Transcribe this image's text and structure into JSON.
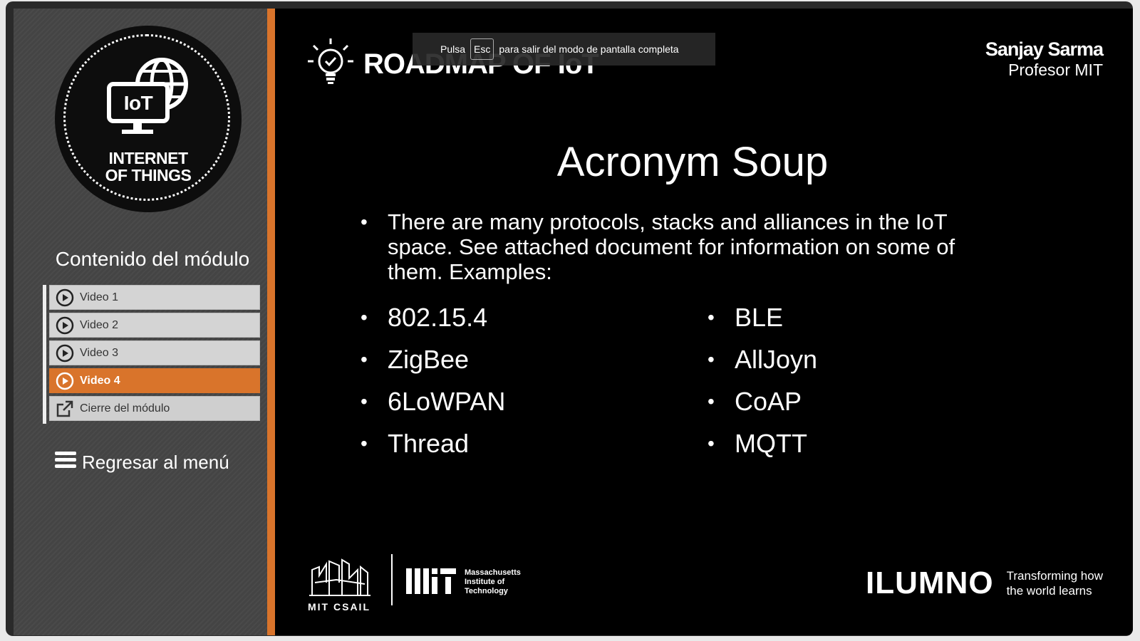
{
  "sidebar": {
    "logo": {
      "line1": "INTERNET",
      "line2": "OF THINGS",
      "badge": "IoT"
    },
    "module_title": "Contenido del módulo",
    "items": [
      {
        "label": "Video 1",
        "icon": "play-circle-icon",
        "active": false
      },
      {
        "label": "Video 2",
        "icon": "play-circle-icon",
        "active": false
      },
      {
        "label": "Video 3",
        "icon": "play-circle-icon",
        "active": false
      },
      {
        "label": "Video 4",
        "icon": "play-circle-icon",
        "active": true
      },
      {
        "label": "Cierre del módulo",
        "icon": "external-link-icon",
        "active": false
      }
    ],
    "back_label": "Regresar al menú"
  },
  "header": {
    "title": "ROADMAP OF IoT",
    "presenter_name": "Sanjay Sarma",
    "presenter_role": "Profesor MIT"
  },
  "toast": {
    "prefix": "Pulsa",
    "key": "Esc",
    "suffix": "para salir del modo de pantalla completa"
  },
  "slide": {
    "title": "Acronym Soup",
    "intro": "There are many protocols, stacks and alliances in the IoT space. See attached document for information on some of them. Examples:",
    "left_column": [
      "802.15.4",
      "ZigBee",
      "6LoWPAN",
      "Thread"
    ],
    "right_column": [
      "BLE",
      "AllJoyn",
      "CoAP",
      "MQTT"
    ]
  },
  "footer": {
    "csail": "MIT CSAIL",
    "mit_line1": "Massachusetts",
    "mit_line2": "Institute of",
    "mit_line3": "Technology",
    "ilumno": "ILUMNO",
    "tagline1": "Transforming how",
    "tagline2": "the world learns"
  },
  "colors": {
    "accent": "#d9742b",
    "slide_bg": "#000000",
    "sidebar_bg": "#474747"
  }
}
